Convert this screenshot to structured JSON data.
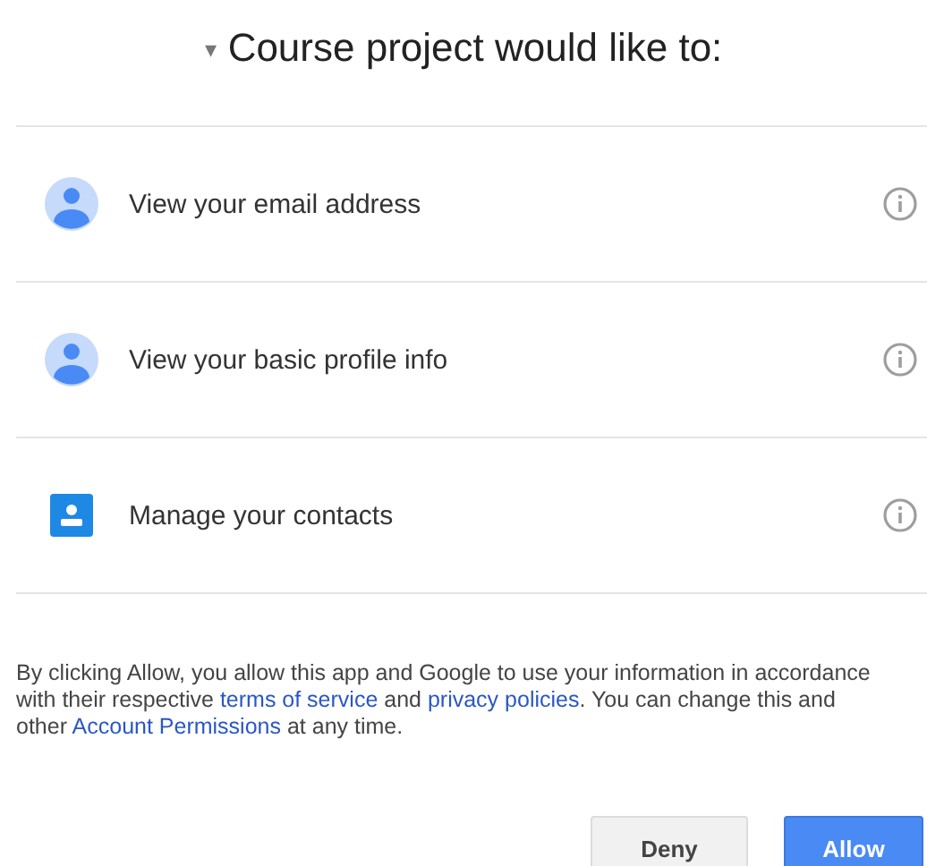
{
  "heading": {
    "caret": "▾",
    "title": "Course project would like to:"
  },
  "permissions": [
    {
      "kind": "person",
      "label": "View your email address"
    },
    {
      "kind": "person",
      "label": "View your basic profile info"
    },
    {
      "kind": "contacts",
      "label": "Manage your contacts"
    }
  ],
  "notice": [
    {
      "kind": "text",
      "text": "By clicking Allow, you allow this app and Google to use your information in accordance with their respective "
    },
    {
      "kind": "link",
      "text": "terms of service"
    },
    {
      "kind": "text",
      "text": " and "
    },
    {
      "kind": "link",
      "text": "privacy policies"
    },
    {
      "kind": "text",
      "text": ". You can change this and other "
    },
    {
      "kind": "link",
      "text": "Account Permissions"
    },
    {
      "kind": "text",
      "text": " at any time."
    }
  ],
  "buttons": [
    {
      "kind": "secondary",
      "label": "Deny"
    },
    {
      "kind": "primary",
      "label": "Allow"
    }
  ]
}
